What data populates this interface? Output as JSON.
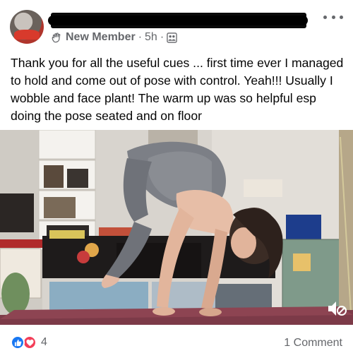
{
  "post": {
    "author_name_redacted": "",
    "member_label": "New Member",
    "time": "5h",
    "separator": "·",
    "body": "Thank you for all the useful cues ... first time ever I managed to hold and come out of pose with control. Yeah!!! Usually I wobble and face plant! The warm up was so helpful esp doing the pose seated and on floor"
  },
  "icons": {
    "member_badge": "wave-hand-icon",
    "audience": "group-icon",
    "more": "more-dots-icon",
    "mute": "mute-icon",
    "like": "like-icon",
    "love": "love-icon"
  },
  "reactions": {
    "count": "4"
  },
  "comments": {
    "label": "1 Comment"
  },
  "colors": {
    "like": "#1877f2",
    "love": "#f33e58",
    "secondary_text": "#65676b",
    "mat": "#7c3a48"
  }
}
